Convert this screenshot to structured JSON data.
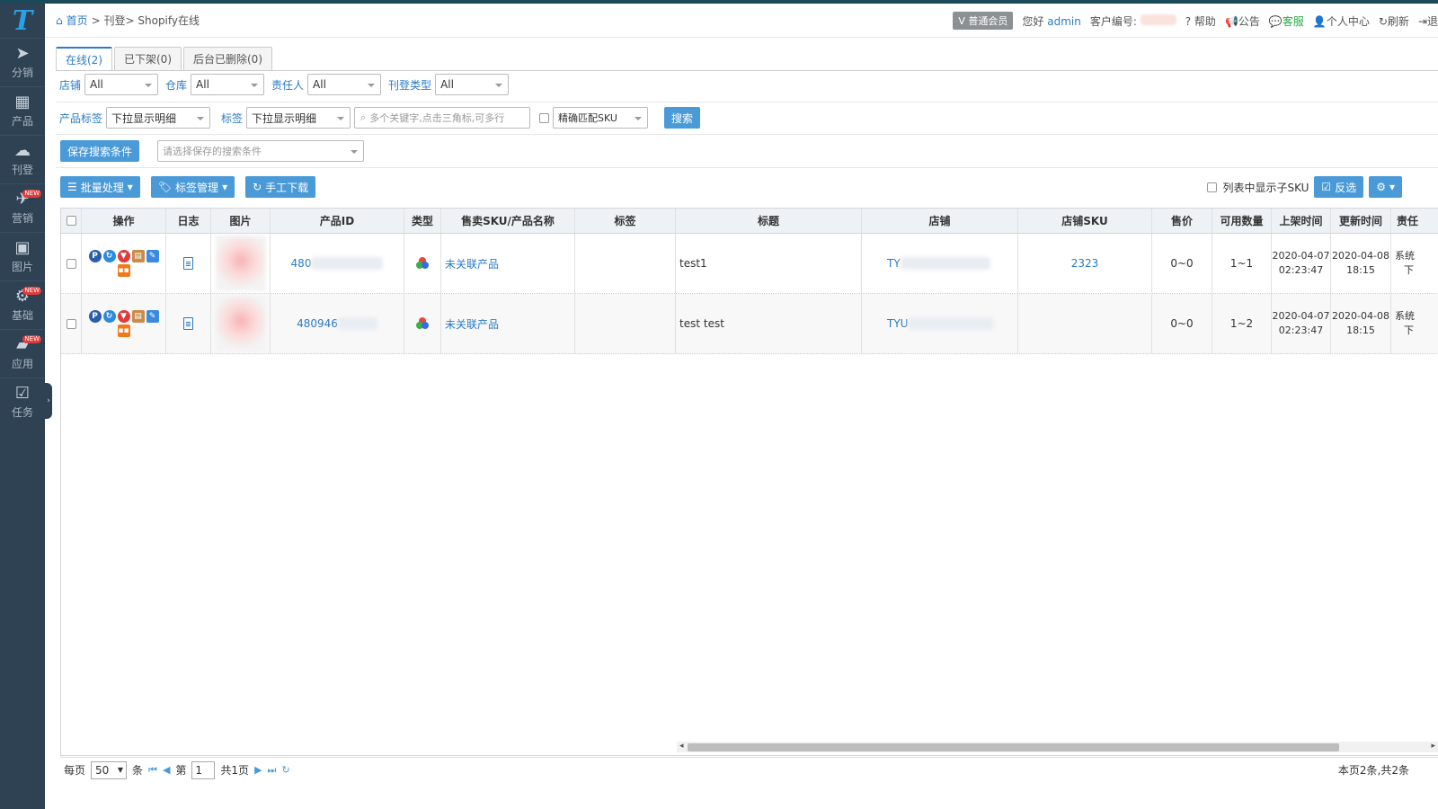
{
  "sidebar": {
    "logo": "T",
    "items": [
      {
        "label": "分销",
        "icon": "paper-plane-icon",
        "new": ""
      },
      {
        "label": "产品",
        "icon": "grid-icon",
        "new": ""
      },
      {
        "label": "刊登",
        "icon": "cloud-upload-icon",
        "new": ""
      },
      {
        "label": "营销",
        "icon": "rocket-icon",
        "new": "NEW"
      },
      {
        "label": "图片",
        "icon": "image-icon",
        "new": ""
      },
      {
        "label": "基础",
        "icon": "gear-icon",
        "new": "NEW"
      },
      {
        "label": "应用",
        "icon": "shopping-bag-icon",
        "new": "NEW"
      },
      {
        "label": "任务",
        "icon": "calendar-check-icon",
        "new": ""
      }
    ]
  },
  "header": {
    "breadcrumb_home": "首页",
    "breadcrumb_rest": "> 刊登> Shopify在线",
    "member_badge": "V 普通会员",
    "greeting": "您好",
    "username": "admin",
    "customer_no_label": "客户编号:",
    "help": "帮助",
    "notice": "公告",
    "service": "客服",
    "personal": "个人中心",
    "refresh": "刷新",
    "logout": "退"
  },
  "tabs": [
    {
      "label": "在线(2)",
      "active": true
    },
    {
      "label": "已下架(0)",
      "active": false
    },
    {
      "label": "后台已删除(0)",
      "active": false
    }
  ],
  "filters": {
    "shop_label": "店铺",
    "shop_value": "All",
    "warehouse_label": "仓库",
    "warehouse_value": "All",
    "owner_label": "责任人",
    "owner_value": "All",
    "listing_type_label": "刊登类型",
    "listing_type_value": "All",
    "product_tag_label": "产品标签",
    "product_tag_value": "下拉显示明细",
    "tag_label": "标签",
    "tag_value": "下拉显示明细",
    "keyword_placeholder": "多个关键字,点击三角标,可多行",
    "match_value": "精确匹配SKU",
    "search_button": "搜索",
    "save_search_button": "保存搜索条件",
    "saved_search_placeholder": "请选择保存的搜索条件"
  },
  "toolbar": {
    "batch": "批量处理",
    "tag_manage": "标签管理",
    "manual_download": "手工下载",
    "show_child_sku": "列表中显示子SKU",
    "invert": "反选"
  },
  "table": {
    "headers": [
      "操作",
      "日志",
      "图片",
      "产品ID",
      "类型",
      "售卖SKU/产品名称",
      "标签",
      "标题",
      "店铺",
      "店铺SKU",
      "售价",
      "可用数量",
      "上架时间",
      "更新时间",
      "责任"
    ],
    "rows": [
      {
        "product_id": "480",
        "sku_name": "未关联产品",
        "tag": "",
        "title": "test1",
        "shop": "TY",
        "shop_sku": "2323",
        "price": "0~0",
        "qty": "1~1",
        "listed_date": "2020-04-07",
        "listed_time": "02:23:47",
        "updated_date": "2020-04-08",
        "updated_time": "18:15",
        "owner1": "系统",
        "owner2": "下"
      },
      {
        "product_id": "480946",
        "sku_name": "未关联产品",
        "tag": "",
        "title": "test test",
        "shop": "TYU",
        "shop_sku": "",
        "price": "0~0",
        "qty": "1~2",
        "listed_date": "2020-04-07",
        "listed_time": "02:23:47",
        "updated_date": "2020-04-08",
        "updated_time": "18:15",
        "owner1": "系统",
        "owner2": "下"
      }
    ]
  },
  "pager": {
    "per_page_label": "每页",
    "per_page_value": "50",
    "per_page_unit": "条",
    "page_prefix": "第",
    "page_value": "1",
    "page_total": "共1页",
    "summary": "本页2条,共2条"
  }
}
